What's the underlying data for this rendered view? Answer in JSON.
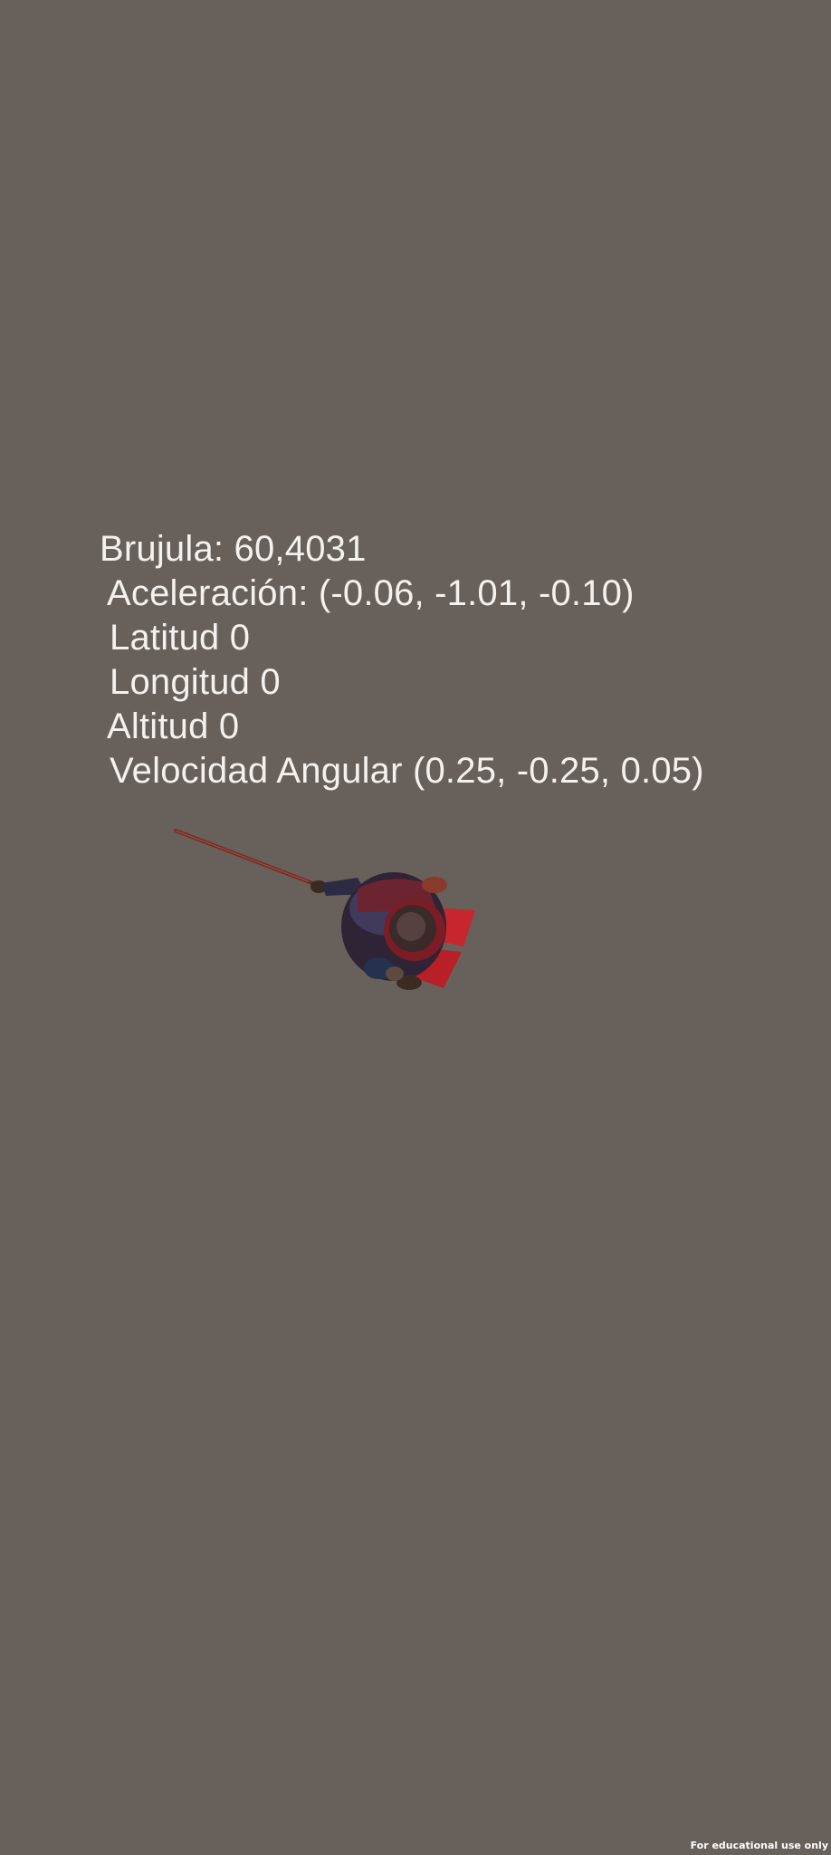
{
  "hud": {
    "compass": "Brujula: 60,4031",
    "acceleration": "Aceleración: (-0.06, -1.01, -0.10)",
    "latitude": "Latitud 0",
    "longitude": "Longitud 0",
    "altitude": "Altitud 0",
    "angular_velocity": "Velocidad Angular (0.25, -0.25, 0.05)"
  },
  "scene": {
    "background_color": "#67605b",
    "character_icon": "samurai-swordsman-topdown"
  },
  "footer": {
    "note": "For educational use only"
  }
}
